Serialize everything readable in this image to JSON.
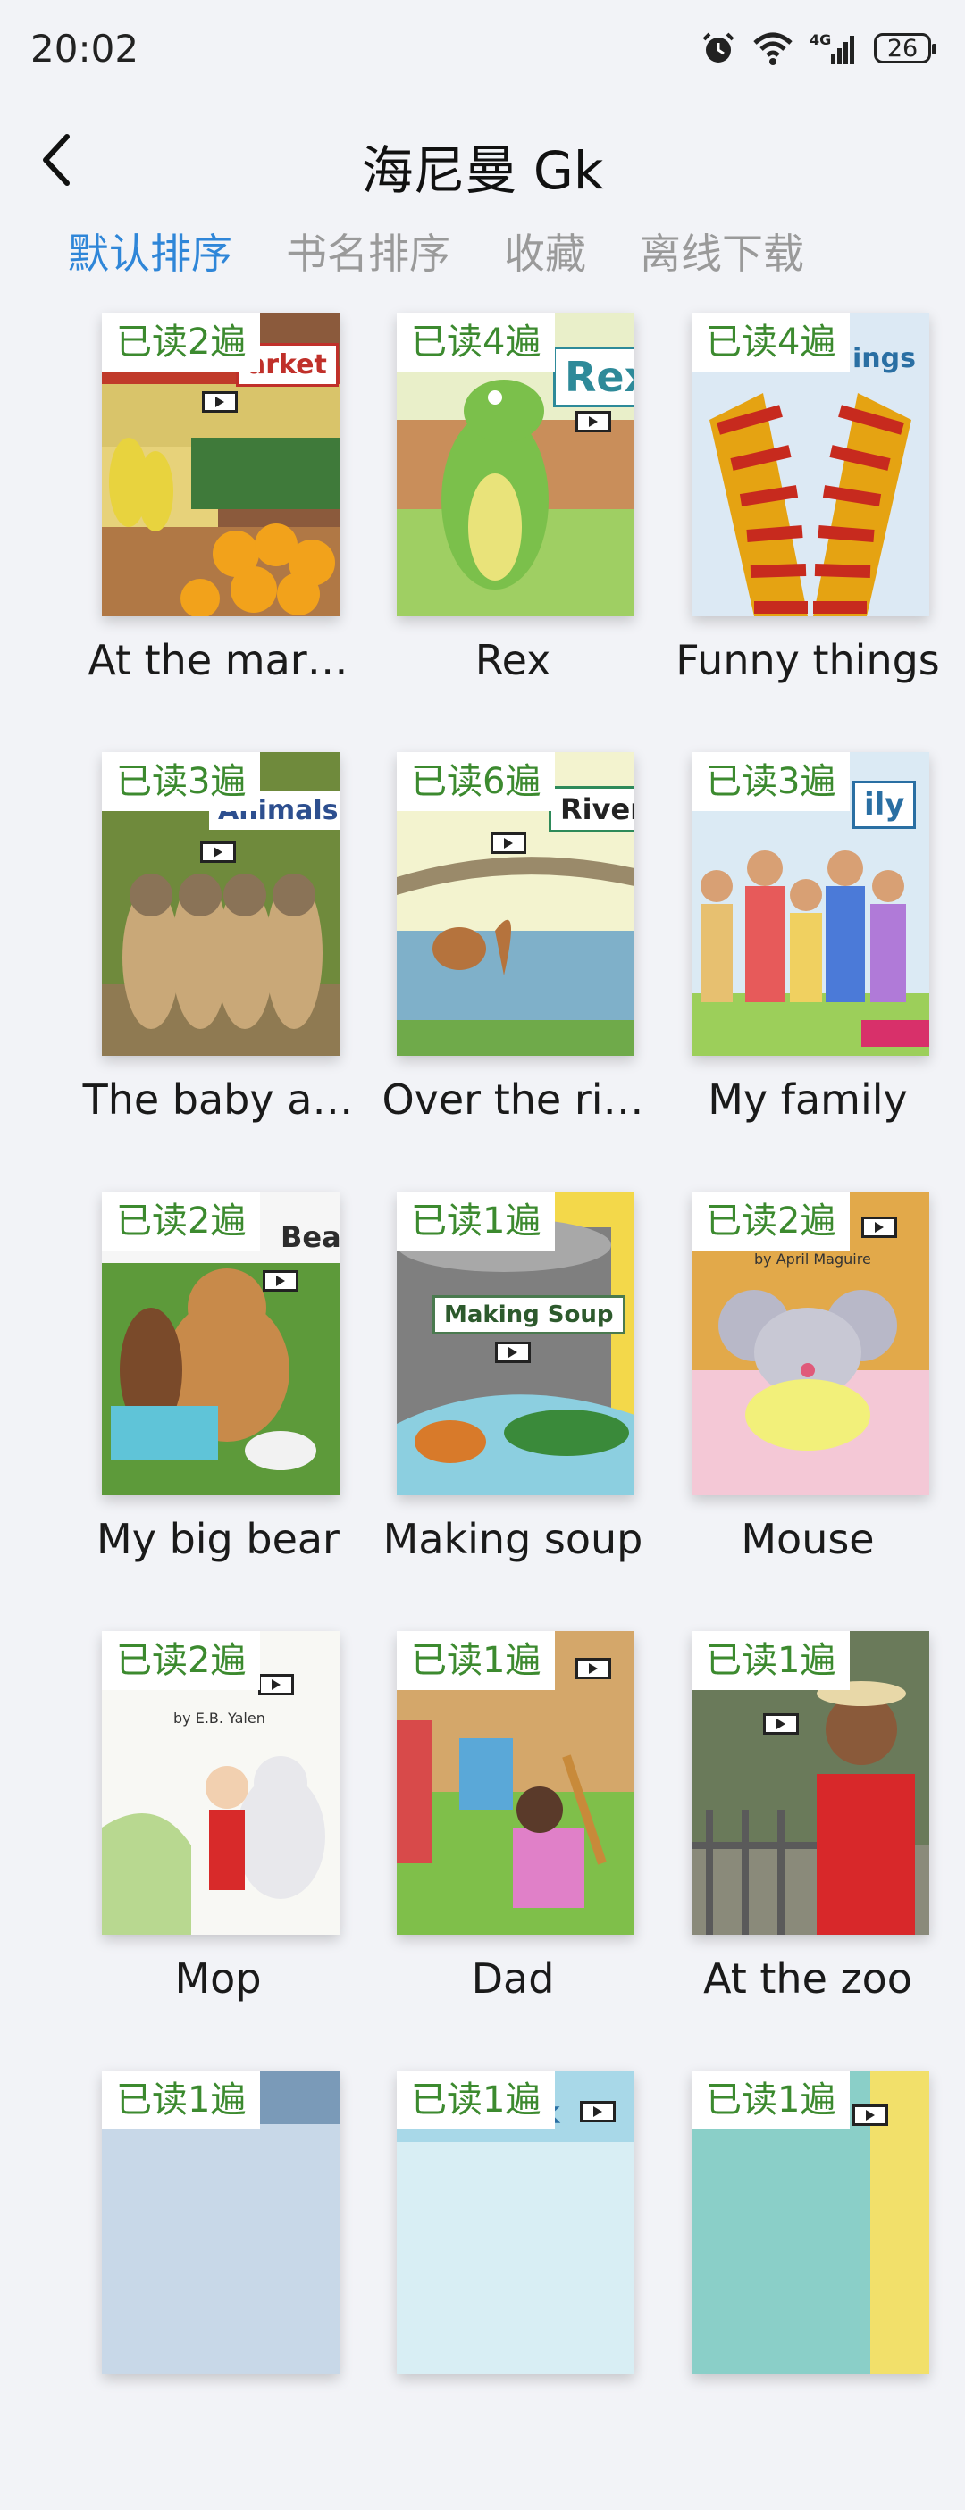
{
  "status": {
    "time": "20:02",
    "battery": "26",
    "signal": "4G"
  },
  "header": {
    "title": "海尼曼 Gk"
  },
  "tabs": [
    {
      "label": "默认排序",
      "active": true
    },
    {
      "label": "书名排序",
      "active": false
    },
    {
      "label": "收藏",
      "active": false
    },
    {
      "label": "离线下载",
      "active": false
    }
  ],
  "books": [
    {
      "title": "At the mar…",
      "badge": "已读2遍",
      "cover_text": "arket"
    },
    {
      "title": "Rex",
      "badge": "已读4遍",
      "cover_text": "Rex"
    },
    {
      "title": "Funny things",
      "badge": "已读4遍",
      "cover_text": "ings"
    },
    {
      "title": "The baby a…",
      "badge": "已读3遍",
      "cover_text": "Animals"
    },
    {
      "title": "Over the ri…",
      "badge": "已读6遍",
      "cover_text": "River"
    },
    {
      "title": "My family",
      "badge": "已读3遍",
      "cover_text": "ily"
    },
    {
      "title": "My big bear",
      "badge": "已读2遍",
      "cover_text": "Bear"
    },
    {
      "title": "Making soup",
      "badge": "已读1遍",
      "cover_text": "Making Soup"
    },
    {
      "title": "Mouse",
      "badge": "已读2遍",
      "cover_text": "by April Maguire"
    },
    {
      "title": "Mop",
      "badge": "已读2遍",
      "cover_text": "by E.B. Yalen"
    },
    {
      "title": "Dad",
      "badge": "已读1遍",
      "cover_text": ""
    },
    {
      "title": "At the zoo",
      "badge": "已读1遍",
      "cover_text": ""
    },
    {
      "title": "",
      "badge": "已读1遍",
      "cover_text": ""
    },
    {
      "title": "",
      "badge": "已读1遍",
      "cover_text": "k"
    },
    {
      "title": "",
      "badge": "已读1遍",
      "cover_text": ""
    }
  ]
}
